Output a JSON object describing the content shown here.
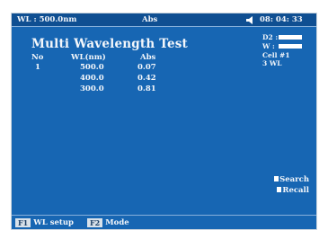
{
  "status_bar": {
    "wl": "WL : 500.0nm",
    "abs": "Abs",
    "time": "08: 04: 33"
  },
  "title": "Multi Wavelength Test",
  "table": {
    "headers": [
      "No",
      "WL(nm)",
      "Abs"
    ],
    "no": "1",
    "rows": [
      {
        "wl": "500.0",
        "abs": "0.07"
      },
      {
        "wl": "400.0",
        "abs": "0.42"
      },
      {
        "wl": "300.0",
        "abs": "0.81"
      }
    ]
  },
  "lamps": [
    {
      "label": "D2 :",
      "level": 1.0
    },
    {
      "label": "W :",
      "level": 1.0
    }
  ],
  "cell": "Cell  #1",
  "wl_count": "3 WL",
  "side_buttons": [
    "Search",
    "Recall"
  ],
  "fkeys": [
    {
      "key": "F1",
      "label": "WL setup"
    },
    {
      "key": "F2",
      "label": "Mode"
    }
  ],
  "icons": [
    "speaker-icon"
  ],
  "colors": {
    "screen": "#1766b3",
    "text": "#f4f7fb",
    "key_bg": "#d9e2ea"
  }
}
